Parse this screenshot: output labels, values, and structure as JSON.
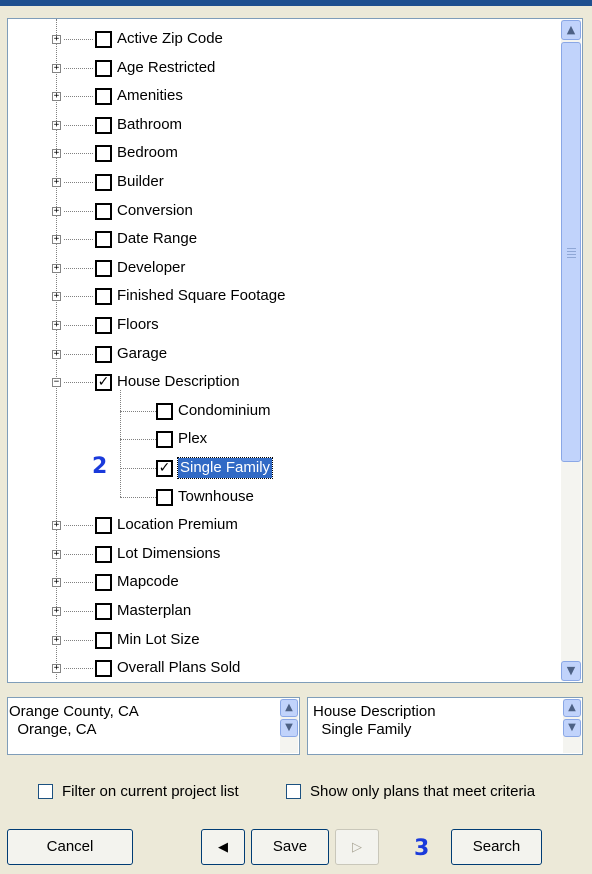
{
  "tree": {
    "items_before": [
      {
        "label": "Active Zip Code",
        "checked": false
      },
      {
        "label": "Age Restricted",
        "checked": false
      },
      {
        "label": "Amenities",
        "checked": false
      },
      {
        "label": "Bathroom",
        "checked": false
      },
      {
        "label": "Bedroom",
        "checked": false
      },
      {
        "label": "Builder",
        "checked": false
      },
      {
        "label": "Conversion",
        "checked": false
      },
      {
        "label": "Date Range",
        "checked": false
      },
      {
        "label": "Developer",
        "checked": false
      },
      {
        "label": "Finished Square Footage",
        "checked": false
      },
      {
        "label": "Floors",
        "checked": false
      },
      {
        "label": "Garage",
        "checked": false
      }
    ],
    "expanded_item": {
      "label": "House Description",
      "checked": true
    },
    "children": [
      {
        "label": "Condominium",
        "checked": false,
        "selected": false
      },
      {
        "label": "Plex",
        "checked": false,
        "selected": false
      },
      {
        "label": "Single Family",
        "checked": true,
        "selected": true
      },
      {
        "label": "Townhouse",
        "checked": false,
        "selected": false
      }
    ],
    "items_after": [
      {
        "label": "Location Premium",
        "checked": false
      },
      {
        "label": "Lot Dimensions",
        "checked": false
      },
      {
        "label": "Mapcode",
        "checked": false
      },
      {
        "label": "Masterplan",
        "checked": false
      },
      {
        "label": "Min Lot Size",
        "checked": false
      },
      {
        "label": "Overall Plans Sold",
        "checked": false
      }
    ],
    "marker_label": "2"
  },
  "location_list": {
    "line1": "Orange County, CA",
    "line2": "  Orange, CA"
  },
  "criteria_list": {
    "line1": "House Description",
    "line2": "  Single Family"
  },
  "options": {
    "filter_label": "Filter on current project list",
    "show_only_label": "Show only plans that meet criteria"
  },
  "buttons": {
    "cancel": "Cancel",
    "save": "Save",
    "search": "Search",
    "marker_label": "3"
  },
  "icons": {
    "expand": "plus-box-icon",
    "collapse": "minus-box-icon",
    "check": "checkmark-icon",
    "scroll_up": "arrow-up-icon",
    "scroll_down": "arrow-down-icon",
    "prev": "arrow-left-icon",
    "next": "arrow-right-icon"
  },
  "colors": {
    "selection": "#316ac5",
    "marker": "#1a3adb",
    "window_bg": "#ece9d8"
  }
}
